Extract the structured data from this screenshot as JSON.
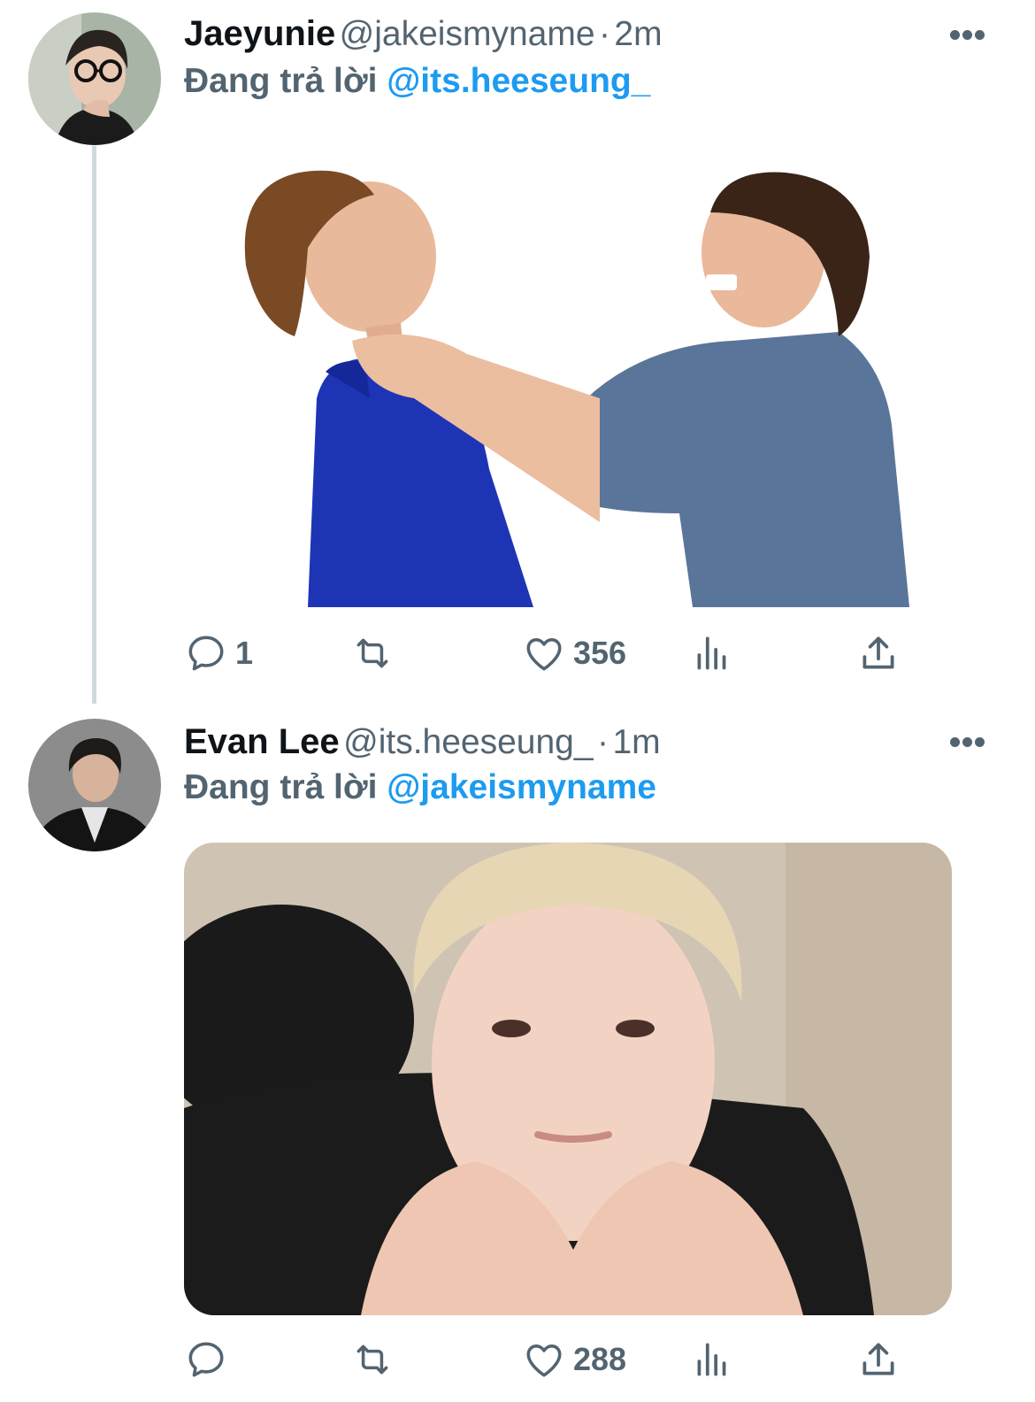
{
  "tweets": [
    {
      "display_name": "Jaeyunie",
      "handle": "@jakeismyname",
      "separator": "·",
      "time": "2m",
      "replying_prefix": "Đang trả lời",
      "replying_to": "@its.heeseung_",
      "actions": {
        "reply_count": "1",
        "retweet_count": "",
        "like_count": "356"
      },
      "avatar_icon": "avatar-photo",
      "media_icon": "photo-two-men-fighting"
    },
    {
      "display_name": "Evan Lee",
      "handle": "@its.heeseung_",
      "separator": "·",
      "time": "1m",
      "replying_prefix": "Đang trả lời",
      "replying_to": "@jakeismyname",
      "actions": {
        "reply_count": "",
        "retweet_count": "",
        "like_count": "288"
      },
      "avatar_icon": "avatar-photo",
      "media_icon": "photo-heart-hands"
    }
  ],
  "colors": {
    "text_primary": "#0f1419",
    "text_secondary": "#536471",
    "accent": "#1d9bf0",
    "thread_line": "#cfd9de"
  }
}
